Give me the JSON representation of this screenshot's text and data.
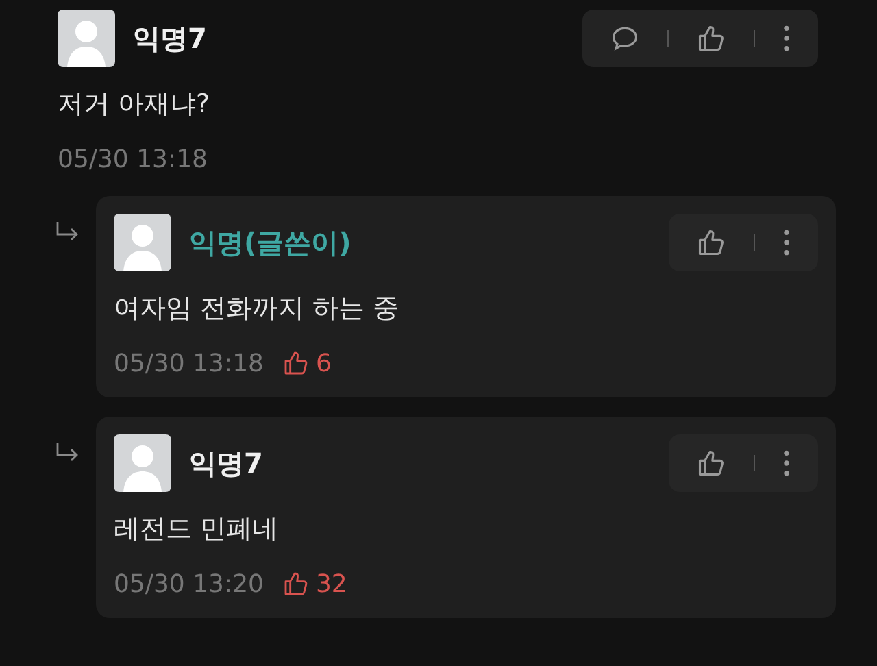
{
  "comments": [
    {
      "kind": "comment",
      "author": "익명7",
      "is_writer": false,
      "body": "저거 아재냐?",
      "time": "05/30 13:18",
      "actions": [
        {
          "kind": "reply"
        },
        {
          "kind": "like"
        },
        {
          "kind": "more"
        }
      ]
    },
    {
      "kind": "reply",
      "author": "익명(글쓴이)",
      "is_writer": true,
      "body": "여자임 전화까지 하는 중",
      "time": "05/30 13:18",
      "likes": "6",
      "actions": [
        {
          "kind": "like"
        },
        {
          "kind": "more"
        }
      ]
    },
    {
      "kind": "reply",
      "author": "익명7",
      "is_writer": false,
      "body": "레전드 민폐네",
      "time": "05/30 13:20",
      "likes": "32",
      "actions": [
        {
          "kind": "like"
        },
        {
          "kind": "more"
        }
      ]
    }
  ]
}
